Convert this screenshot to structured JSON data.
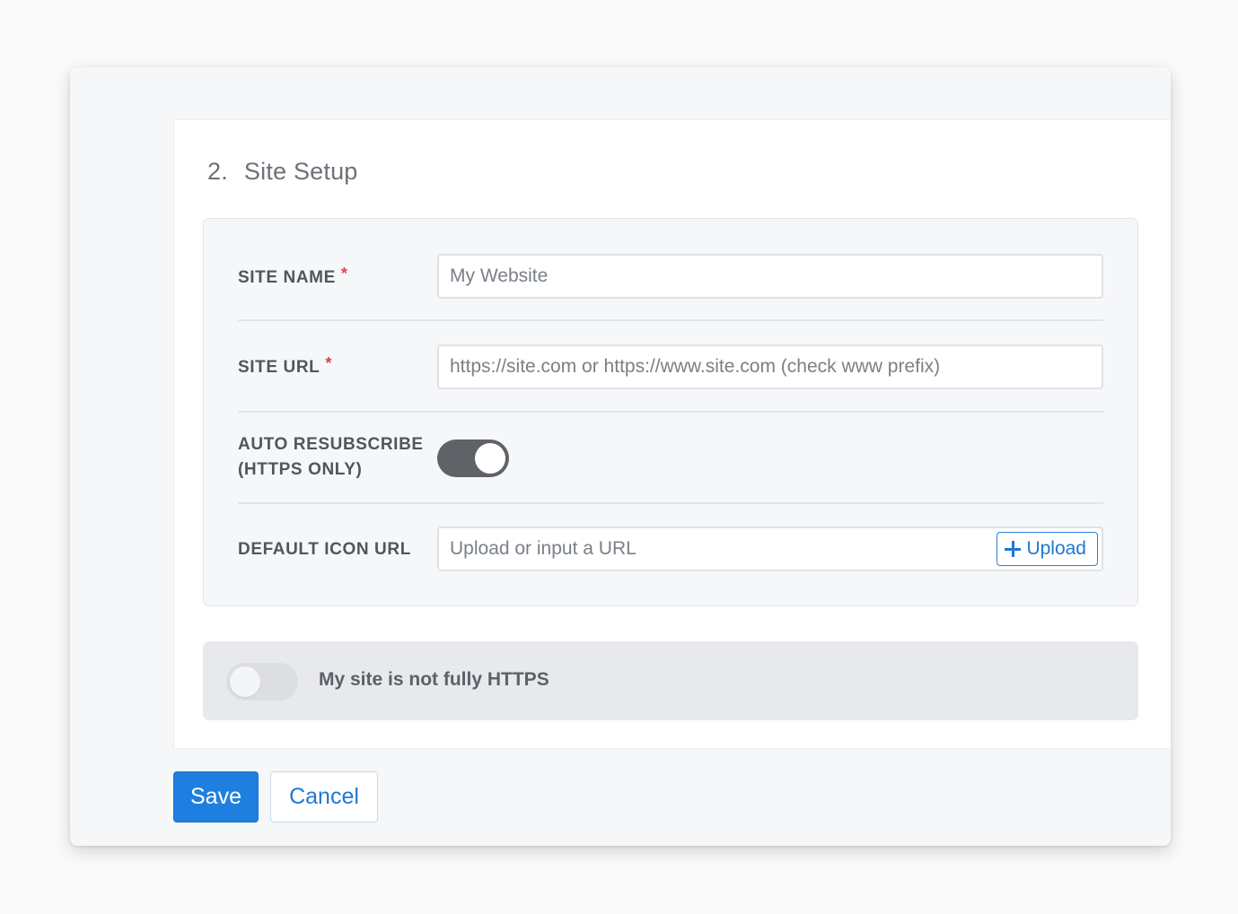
{
  "section": {
    "number": "2.",
    "title": "Site Setup"
  },
  "form": {
    "site_name": {
      "label": "SITE NAME",
      "required_mark": "*",
      "value": "",
      "placeholder": "My Website"
    },
    "site_url": {
      "label": "SITE URL",
      "required_mark": "*",
      "value": "",
      "placeholder": "https://site.com or https://www.site.com (check www prefix)"
    },
    "auto_resubscribe": {
      "label_line1": "AUTO RESUBSCRIBE",
      "label_line2": "(HTTPS ONLY)",
      "enabled": true
    },
    "default_icon_url": {
      "label": "DEFAULT ICON URL",
      "value": "",
      "placeholder": "Upload or input a URL",
      "upload_label": "Upload",
      "upload_icon": "plus-icon"
    }
  },
  "https_option": {
    "label": "My site is not fully HTTPS",
    "enabled": false
  },
  "actions": {
    "save_label": "Save",
    "cancel_label": "Cancel"
  },
  "colors": {
    "primary": "#1e7fe0",
    "toggle_on": "#5f6368",
    "toggle_off": "#dcdee1",
    "required": "#e0434c"
  }
}
